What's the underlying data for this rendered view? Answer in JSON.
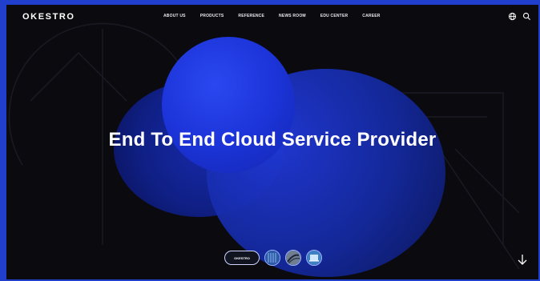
{
  "header": {
    "logo": "OKESTRO",
    "nav": [
      "ABOUT US",
      "PRODUCTS",
      "REFERENCE",
      "NEWS ROOM",
      "EDU CENTER",
      "CAREER"
    ],
    "icons": [
      "globe-icon",
      "search-icon"
    ]
  },
  "hero": {
    "title": "End To End Cloud Service Provider"
  },
  "slider": {
    "active_label": "OKESTRO",
    "thumbnails": [
      "server-thumb",
      "cable-thumb",
      "laptop-thumb"
    ]
  },
  "scroll": {
    "icon": "arrow-down-icon"
  },
  "colors": {
    "frame_border": "#1f3fcc",
    "background": "#0b0b0f",
    "accent": "#2038d8"
  }
}
